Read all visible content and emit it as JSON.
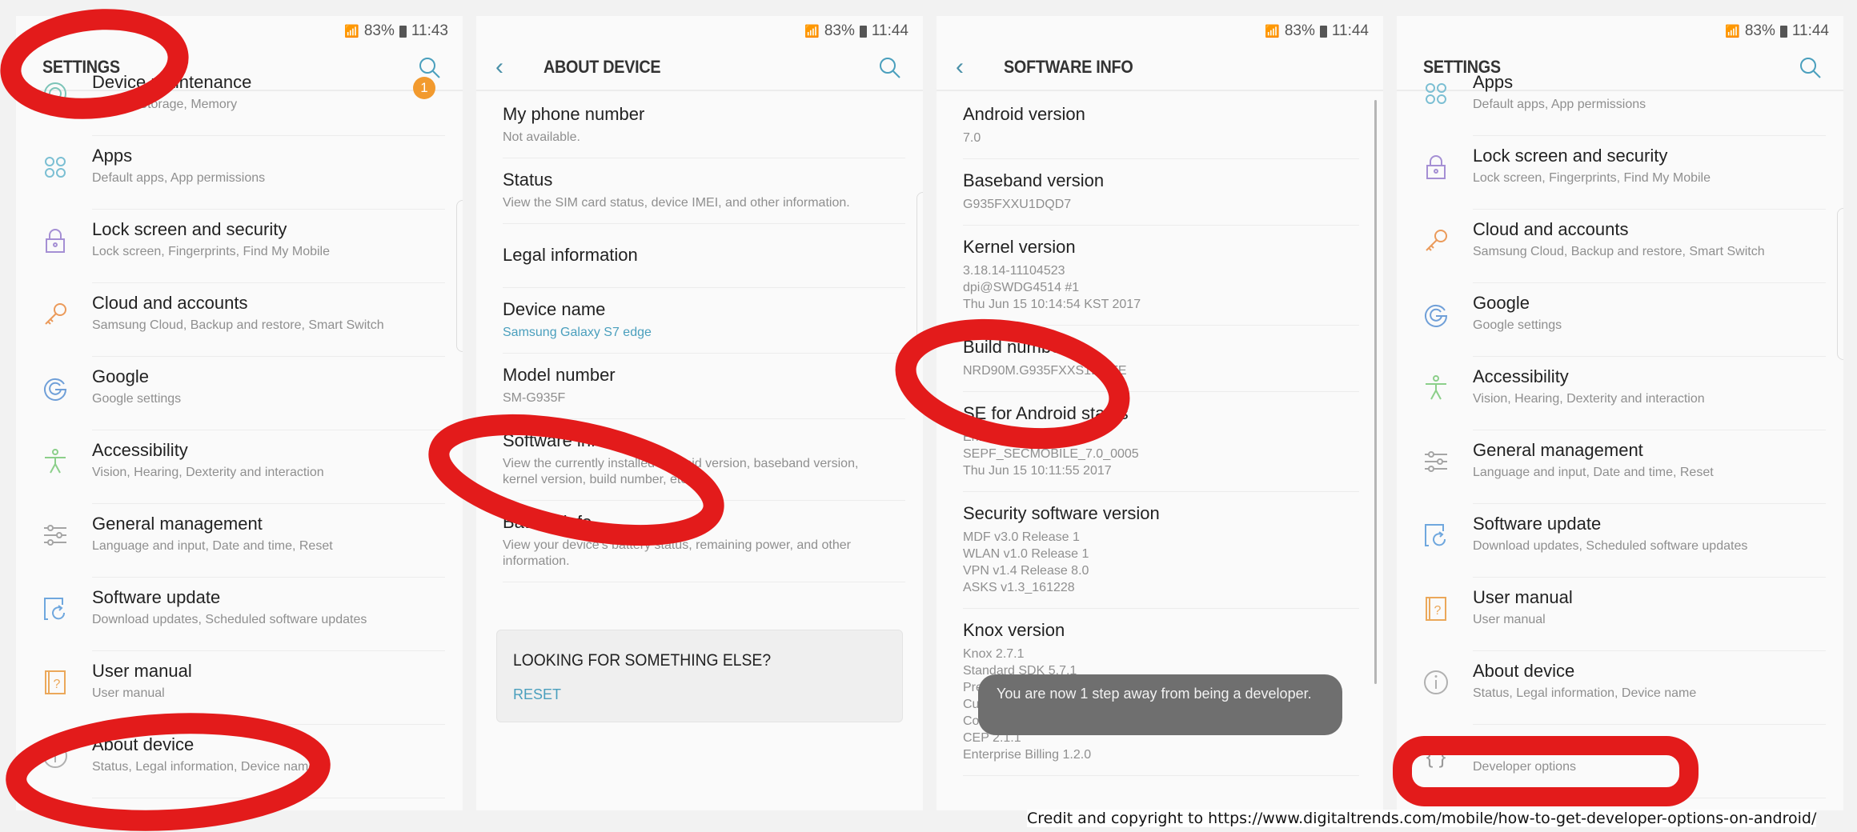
{
  "panels": [
    {
      "status": {
        "battery": "83%",
        "time": "11:43"
      },
      "header": {
        "title": "SETTINGS"
      },
      "items": [
        {
          "title": "Device maintenance",
          "subtitle": "Battery, Storage, Memory",
          "icon": "device-maintenance-icon",
          "badge": "1"
        },
        {
          "title": "Apps",
          "subtitle": "Default apps, App permissions",
          "icon": "apps-icon"
        },
        {
          "title": "Lock screen and security",
          "subtitle": "Lock screen, Fingerprints, Find My Mobile",
          "icon": "lock-icon"
        },
        {
          "title": "Cloud and accounts",
          "subtitle": "Samsung Cloud, Backup and restore, Smart Switch",
          "icon": "key-icon"
        },
        {
          "title": "Google",
          "subtitle": "Google settings",
          "icon": "google-icon"
        },
        {
          "title": "Accessibility",
          "subtitle": "Vision, Hearing, Dexterity and interaction",
          "icon": "accessibility-icon"
        },
        {
          "title": "General management",
          "subtitle": "Language and input, Date and time, Reset",
          "icon": "sliders-icon"
        },
        {
          "title": "Software update",
          "subtitle": "Download updates, Scheduled software updates",
          "icon": "software-update-icon"
        },
        {
          "title": "User manual",
          "subtitle": "User manual",
          "icon": "user-manual-icon"
        },
        {
          "title": "About device",
          "subtitle": "Status, Legal information, Device name",
          "icon": "info-icon"
        }
      ]
    },
    {
      "status": {
        "battery": "83%",
        "time": "11:44"
      },
      "header": {
        "title": "ABOUT DEVICE"
      },
      "items": [
        {
          "title": "My phone number",
          "subtitle": "Not available."
        },
        {
          "title": "Status",
          "subtitle": "View the SIM card status, device IMEI, and other information."
        },
        {
          "title": "Legal information",
          "subtitle": ""
        },
        {
          "title": "Device name",
          "subtitle": "Samsung Galaxy S7 edge"
        },
        {
          "title": "Model number",
          "subtitle": "SM-G935F"
        },
        {
          "title": "Software info",
          "subtitle": "View the currently installed Android version, baseband version, kernel version, build number, etc."
        },
        {
          "title": "Battery info",
          "subtitle": "View your device's battery status, remaining power, and other information."
        }
      ],
      "looking": {
        "title": "LOOKING FOR SOMETHING ELSE?",
        "link": "RESET"
      }
    },
    {
      "status": {
        "battery": "83%",
        "time": "11:44"
      },
      "header": {
        "title": "SOFTWARE INFO"
      },
      "items": [
        {
          "title": "Android version",
          "lines": [
            "7.0"
          ]
        },
        {
          "title": "Baseband version",
          "lines": [
            "G935FXXU1DQD7"
          ]
        },
        {
          "title": "Kernel version",
          "lines": [
            "3.18.14-11104523",
            "dpi@SWDG4514 #1",
            "Thu Jun 15 10:14:54 KST 2017"
          ]
        },
        {
          "title": "Build number",
          "lines": [
            "NRD90M.G935FXXS1DQFE"
          ]
        },
        {
          "title": "SE for Android status",
          "lines": [
            "Enforcing",
            "SEPF_SECMOBILE_7.0_0005",
            "Thu Jun 15 10:11:55 2017"
          ]
        },
        {
          "title": "Security software version",
          "lines": [
            "MDF v3.0 Release 1",
            "WLAN v1.0 Release 1",
            "VPN v1.4 Release 8.0",
            "ASKS v1.3_161228"
          ]
        },
        {
          "title": "Knox version",
          "lines": [
            "Knox 2.7.1",
            "Standard SDK 5.7.1",
            "Premium SDK 2.7.1",
            "Customization SDK 2.7.1",
            "Container 2.7.1",
            "CEP 2.1.1",
            "Enterprise Billing 1.2.0"
          ]
        }
      ],
      "toast": "You are now 1 step away from being a developer."
    },
    {
      "status": {
        "battery": "83%",
        "time": "11:44"
      },
      "header": {
        "title": "SETTINGS"
      },
      "items": [
        {
          "title": "Apps",
          "subtitle": "Default apps, App permissions",
          "icon": "apps-icon"
        },
        {
          "title": "Lock screen and security",
          "subtitle": "Lock screen, Fingerprints, Find My Mobile",
          "icon": "lock-icon"
        },
        {
          "title": "Cloud and accounts",
          "subtitle": "Samsung Cloud, Backup and restore, Smart Switch",
          "icon": "key-icon"
        },
        {
          "title": "Google",
          "subtitle": "Google settings",
          "icon": "google-icon"
        },
        {
          "title": "Accessibility",
          "subtitle": "Vision, Hearing, Dexterity and interaction",
          "icon": "accessibility-icon"
        },
        {
          "title": "General management",
          "subtitle": "Language and input, Date and time, Reset",
          "icon": "sliders-icon"
        },
        {
          "title": "Software update",
          "subtitle": "Download updates, Scheduled software updates",
          "icon": "software-update-icon"
        },
        {
          "title": "User manual",
          "subtitle": "User manual",
          "icon": "user-manual-icon"
        },
        {
          "title": "About device",
          "subtitle": "Status, Legal information, Device name",
          "icon": "info-icon"
        },
        {
          "title": "Developer options",
          "subtitle": "Developer options",
          "icon": "developer-braces-icon"
        }
      ]
    }
  ],
  "credit": "Credit and copyright to https://www.digitaltrends.com/mobile/how-to-get-developer-options-on-android/",
  "colors": {
    "accent": "#4a9fbd",
    "badge": "#f29a2e",
    "annotation": "#e31b1b",
    "toast": "#6f6f6f"
  }
}
